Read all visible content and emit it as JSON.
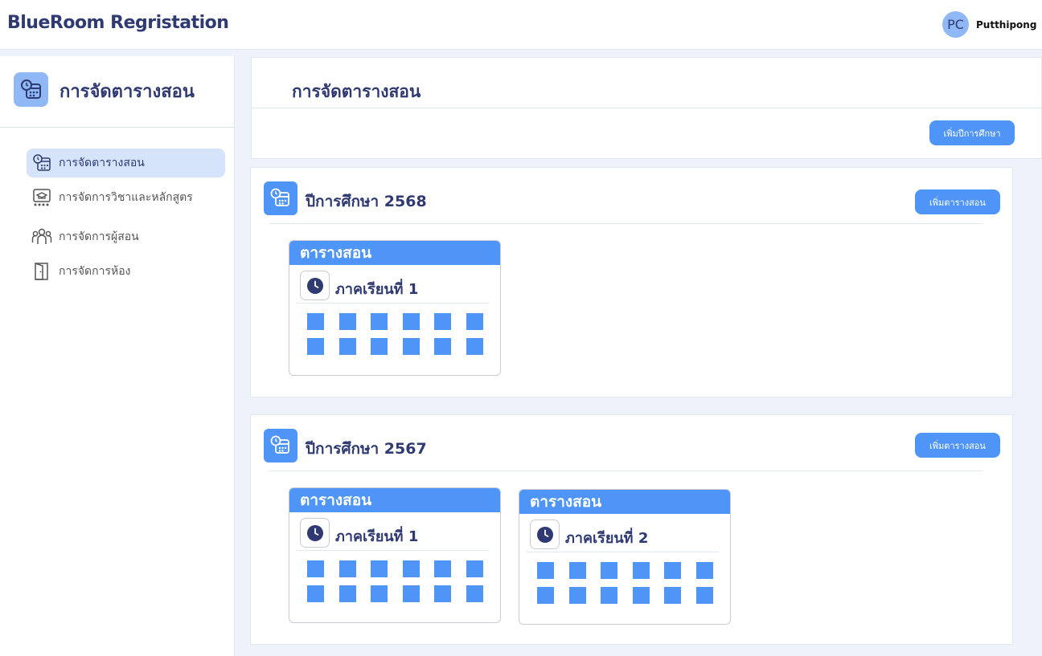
{
  "header": {
    "brand": "BlueRoom Regristation",
    "avatar_initials": "PC",
    "username": "Putthipong"
  },
  "sidebar": {
    "title": "การจัดตารางสอน",
    "items": [
      {
        "label": "การจัดตารางสอน",
        "icon": "calendar-clock-icon",
        "active": true
      },
      {
        "label": "การจัดการวิชาและหลักสูตร",
        "icon": "graduation-board-icon",
        "active": false
      },
      {
        "label": "การจัดการผู้สอน",
        "icon": "users-icon",
        "active": false
      },
      {
        "label": "การจัดการห้อง",
        "icon": "door-icon",
        "active": false
      }
    ]
  },
  "main": {
    "title": "การจัดตารางสอน",
    "add_year_label": "เพิ่มปีการศึกษา",
    "years": [
      {
        "title": "ปีการศึกษา 2568",
        "add_schedule_label": "เพิ่มตารางสอน",
        "schedules": [
          {
            "header": "ตารางสอน",
            "term": "ภาคเรียนที่ 1"
          }
        ]
      },
      {
        "title": "ปีการศึกษา 2567",
        "add_schedule_label": "เพิ่มตารางสอน",
        "schedules": [
          {
            "header": "ตารางสอน",
            "term": "ภาคเรียนที่ 1"
          },
          {
            "header": "ตารางสอน",
            "term": "ภาคเรียนที่ 2"
          }
        ]
      }
    ]
  },
  "colors": {
    "accent": "#4e95f7",
    "accent_light": "#8fb8f5",
    "navy": "#2f3a72",
    "active_bg": "#d5e3fb"
  }
}
